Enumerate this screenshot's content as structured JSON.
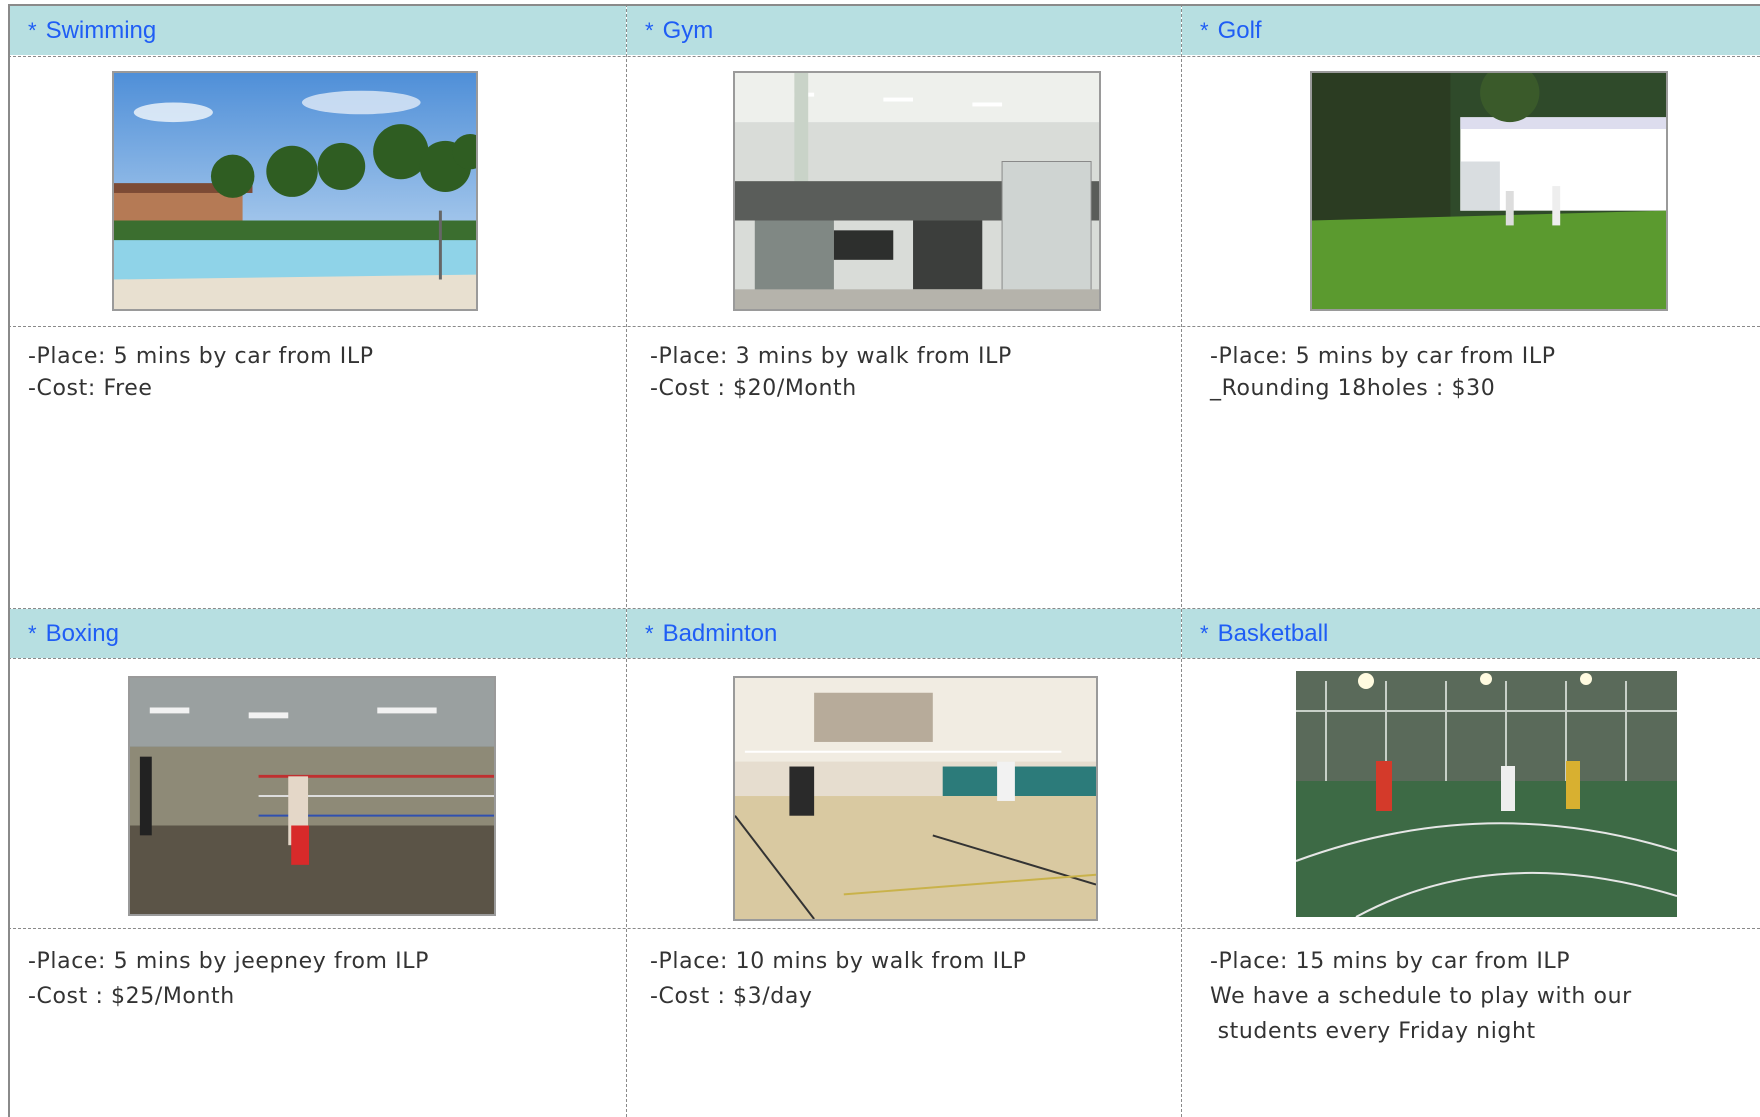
{
  "cells": [
    {
      "title": "Swimming",
      "bullet": "*",
      "photo_icon": "swimming-pool-photo",
      "lines": [
        "-Place: 5 mins by car from ILP",
        "-Cost: Free"
      ]
    },
    {
      "title": "Gym",
      "bullet": "*",
      "photo_icon": "gym-photo",
      "lines": [
        "-Place: 3 mins by walk from ILP",
        "-Cost : $20/Month"
      ]
    },
    {
      "title": "Golf",
      "bullet": "*",
      "photo_icon": "golf-photo",
      "lines": [
        "-Place: 5 mins by car from ILP",
        "_Rounding 18holes : $30"
      ]
    },
    {
      "title": "Boxing",
      "bullet": "*",
      "photo_icon": "boxing-gym-photo",
      "lines": [
        "-Place: 5 mins by jeepney from ILP",
        "-Cost : $25/Month"
      ]
    },
    {
      "title": "Badminton",
      "bullet": "*",
      "photo_icon": "badminton-court-photo",
      "lines": [
        "-Place: 10 mins by walk from ILP",
        "-Cost : $3/day"
      ]
    },
    {
      "title": "Basketball",
      "bullet": "*",
      "photo_icon": "basketball-court-photo",
      "lines": [
        "-Place: 15 mins by car from ILP",
        "We have a schedule to play with our",
        " students every Friday night"
      ]
    }
  ],
  "colors": {
    "header_bg": "#b7dfe1",
    "header_text": "#1f5df5",
    "body_text": "#333333",
    "grid": "#8a8a8a"
  }
}
